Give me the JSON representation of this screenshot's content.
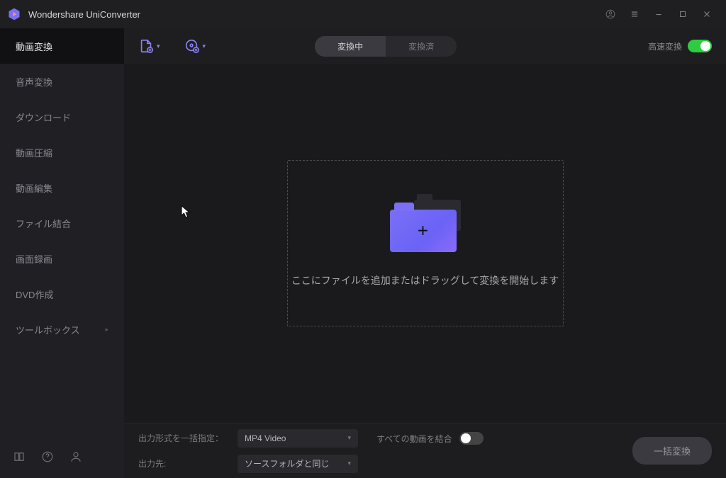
{
  "app": {
    "title": "Wondershare UniConverter"
  },
  "sidebar": {
    "items": [
      {
        "label": "動画変換"
      },
      {
        "label": "音声変換"
      },
      {
        "label": "ダウンロード"
      },
      {
        "label": "動画圧縮"
      },
      {
        "label": "動画編集"
      },
      {
        "label": "ファイル結合"
      },
      {
        "label": "画面録画"
      },
      {
        "label": "DVD作成"
      },
      {
        "label": "ツールボックス"
      }
    ]
  },
  "toolbar": {
    "tabs": {
      "in_progress": "変換中",
      "done": "変換済"
    },
    "fast_label": "高速変換"
  },
  "dropzone": {
    "text": "ここにファイルを追加またはドラッグして変換を開始します"
  },
  "footer": {
    "format_label": "出力形式を一括指定：",
    "format_value": "MP4 Video",
    "dest_label": "出力先:",
    "dest_value": "ソースフォルダと同じ",
    "merge_label": "すべての動画を結合",
    "convert_all": "一括変換"
  }
}
